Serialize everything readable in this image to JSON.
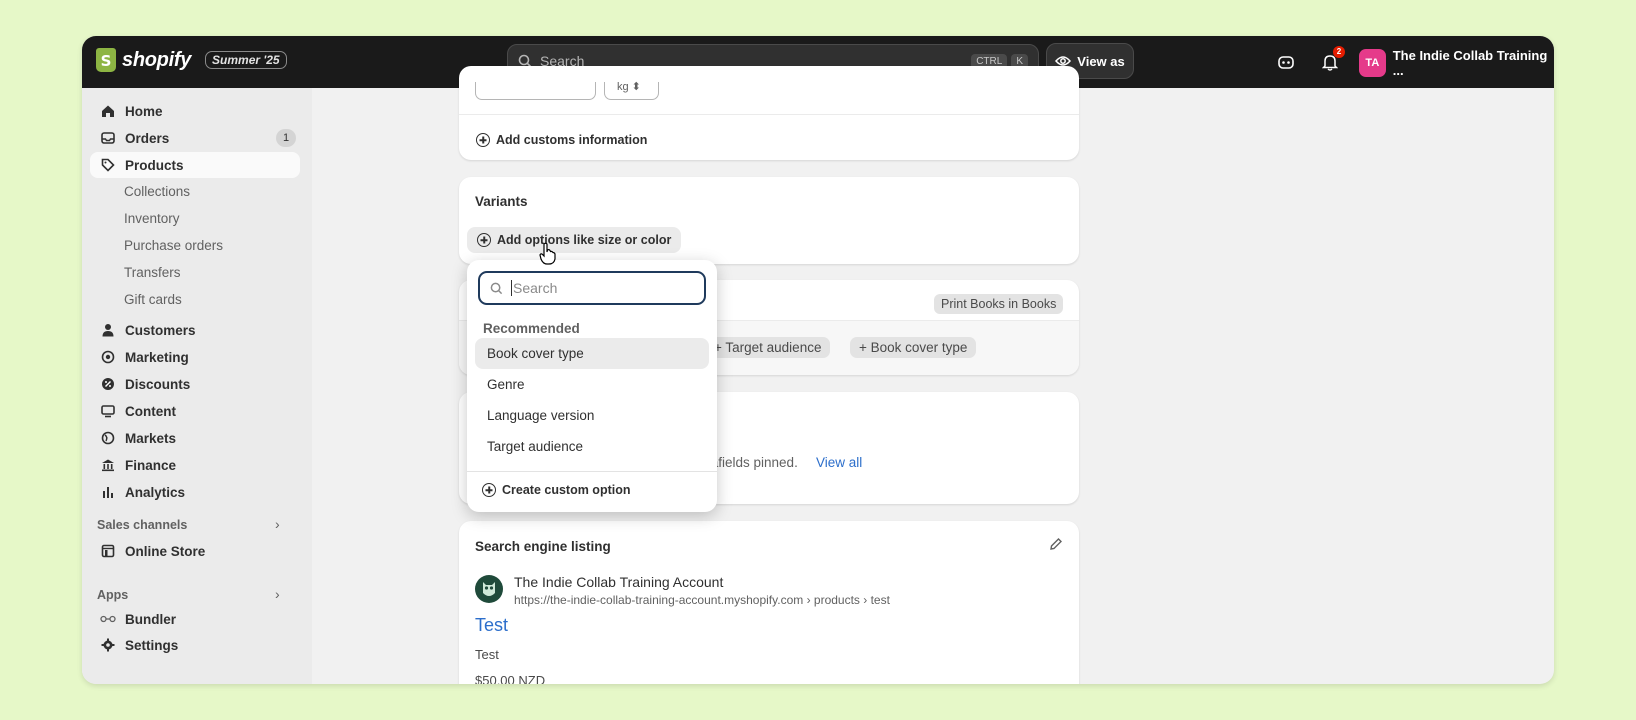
{
  "topbar": {
    "logo_text": "shopify",
    "edition_badge": "Summer '25",
    "search_placeholder": "Search",
    "shortcut_ctrl": "CTRL",
    "shortcut_key": "K",
    "view_as_label": "View as",
    "notification_count": "2",
    "avatar_initials": "TA",
    "store_name": "The Indie Collab Training ..."
  },
  "sidebar": {
    "home": "Home",
    "orders": "Orders",
    "orders_count": "1",
    "products": "Products",
    "collections": "Collections",
    "inventory": "Inventory",
    "purchase_orders": "Purchase orders",
    "transfers": "Transfers",
    "gift_cards": "Gift cards",
    "customers": "Customers",
    "marketing": "Marketing",
    "discounts": "Discounts",
    "content": "Content",
    "markets": "Markets",
    "finance": "Finance",
    "analytics": "Analytics",
    "sales_channels": "Sales channels",
    "online_store": "Online Store",
    "apps": "Apps",
    "bundler": "Bundler",
    "settings": "Settings"
  },
  "shipping": {
    "weight_unit": "kg",
    "add_customs": "Add customs information"
  },
  "variants": {
    "title": "Variants",
    "add_options": "Add options like size or color"
  },
  "dropdown": {
    "search_placeholder": "Search",
    "recommended_label": "Recommended",
    "options": [
      "Book cover type",
      "Genre",
      "Language version",
      "Target audience"
    ],
    "create_custom": "Create custom option"
  },
  "category": {
    "badge": "Print Books in Books",
    "suggestions": [
      "Target audience",
      "Book cover type"
    ]
  },
  "metafields": {
    "text": "tafields pinned.",
    "view_all": "View all"
  },
  "seo": {
    "title": "Search engine listing",
    "store_name": "The Indie Collab Training Account",
    "url": "https://the-indie-collab-training-account.myshopify.com › products › test",
    "page_title": "Test",
    "description": "Test",
    "price": "$50.00 NZD"
  },
  "colors": {
    "accent_link": "#2c6ecb",
    "active_avatar": "#e53a8a",
    "topbar": "#1a1a1a"
  }
}
